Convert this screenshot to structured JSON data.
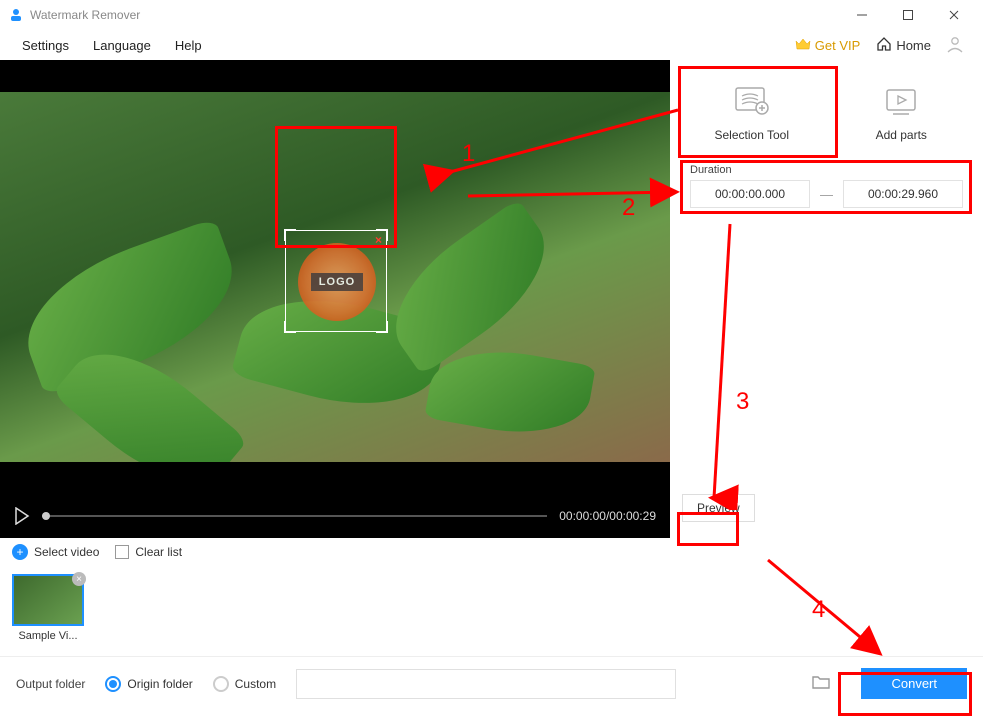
{
  "window": {
    "title": "Watermark Remover"
  },
  "menu": {
    "settings": "Settings",
    "language": "Language",
    "help": "Help",
    "getvip": "Get VIP",
    "home": "Home"
  },
  "player": {
    "timecode": "00:00:00/00:00:29"
  },
  "tools": {
    "selection": "Selection Tool",
    "addparts": "Add parts"
  },
  "duration": {
    "label": "Duration",
    "start": "00:00:00.000",
    "end": "00:00:29.960"
  },
  "preview": "Preview",
  "clips": {
    "select": "Select video",
    "clear": "Clear list",
    "item0": "Sample Vi..."
  },
  "watermark": {
    "text": "LOGO"
  },
  "output": {
    "label": "Output folder",
    "origin": "Origin folder",
    "custom": "Custom",
    "convert": "Convert"
  },
  "annotations": {
    "n1": "1",
    "n2": "2",
    "n3": "3",
    "n4": "4"
  }
}
